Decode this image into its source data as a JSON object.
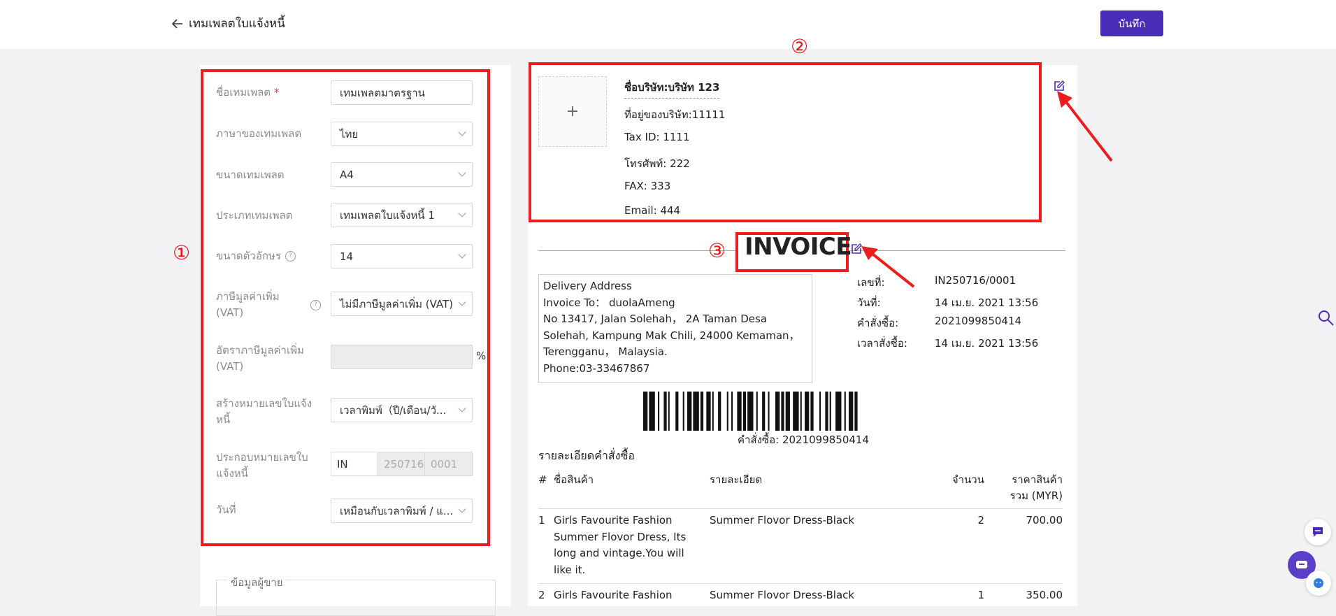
{
  "header": {
    "back_label": "เทมเพลตใบแจ้งหนี้",
    "save_label": "บันทึก"
  },
  "markers": {
    "m1": "①",
    "m2": "②",
    "m3": "③"
  },
  "form": {
    "template_name_label": "ชื่อเทมเพลต",
    "required_mark": "*",
    "template_name_value": "เทมเพลตมาตรฐาน",
    "language_label": "ภาษาของเทมเพลต",
    "language_value": "ไทย",
    "size_label": "ขนาดเทมเพลต",
    "size_value": "A4",
    "type_label": "ประเภทเทมเพลต",
    "type_value": "เทมเพลตใบแจ้งหนี้ 1",
    "font_size_label": "ขนาดตัวอักษร",
    "font_size_value": "14",
    "vat_label": "ภาษีมูลค่าเพิ่ม (VAT)",
    "vat_value": "ไม่มีภาษีมูลค่าเพิ่ม (VAT)",
    "vat_rate_label": "อัตราภาษีมูลค่าเพิ่ม (VAT)",
    "vat_rate_value": "",
    "percent": "%",
    "create_number_label": "สร้างหมายเลขใบแจ้งหนี้",
    "create_number_value": "เวลาพิมพ์（ปี/เดือน/วั...",
    "compose_number_label": "ประกอบหมายเลขใบแจ้งหนี้",
    "prefix_value": "IN",
    "date_part_placeholder": "250716",
    "seq_part_placeholder": "0001",
    "date_label": "วันที่",
    "date_value": "เหมือนกับเวลาพิมพ์ / แ...",
    "help_glyph": "?"
  },
  "seller": {
    "label": "ข้อมูลผู้ขาย"
  },
  "company": {
    "logo_add": "+",
    "name": "ชื่อบริษัท:บริษัท 123",
    "address": "ที่อยู่ของบริษัท:11111",
    "tax_id": "Tax ID: 1111",
    "phone": "โทรศัพท์: 222",
    "fax": "FAX: 333",
    "email": "Email:  444"
  },
  "invoice": {
    "title": "INVOICE",
    "address_lines": [
      "Delivery Address",
      "Invoice To：  duolaAmeng",
      "No 13417, Jalan Solehah， 2A Taman Desa",
      "Solehah, Kampung Mak Chili, 24000 Kemaman，",
      "Terengganu， Malaysia.",
      "Phone:03-33467867"
    ],
    "meta": [
      {
        "label": "เลขที่:",
        "value": "IN250716/0001"
      },
      {
        "label": "วันที่:",
        "value": "14 เม.ย. 2021 13:56"
      },
      {
        "label": "คำสั่งซื้อ:",
        "value": "2021099850414"
      },
      {
        "label": "เวลาสั่งซื้อ:",
        "value": "14 เม.ย. 2021 13:56"
      }
    ],
    "barcode_text": "คำสั่งซื้อ: 2021099850414",
    "details_heading": "รายละเอียดคำสั่งซื้อ",
    "columns": {
      "num": "#",
      "product": "ชื่อสินค้า",
      "detail": "รายละเอียด",
      "qty": "จำนวน",
      "total": "ราคาสินค้ารวม (MYR)"
    },
    "rows": [
      {
        "num": "1",
        "product": "Girls Favourite Fashion Summer Flovor Dress, Its long and vintage.You will like it.",
        "detail": "Summer Flovor Dress-Black",
        "qty": "2",
        "total": "700.00"
      },
      {
        "num": "2",
        "product": "Girls Favourite Fashion",
        "detail": "Summer Flovor Dress-Black",
        "qty": "1",
        "total": "350.00"
      }
    ]
  },
  "colors": {
    "accent": "#4a2db6",
    "annotation_red": "#ee1d1d"
  },
  "icons": [
    "back-arrow-icon",
    "chevron-down-icon",
    "help-icon",
    "edit-icon",
    "search-icon",
    "chat-icon",
    "support-icon"
  ]
}
